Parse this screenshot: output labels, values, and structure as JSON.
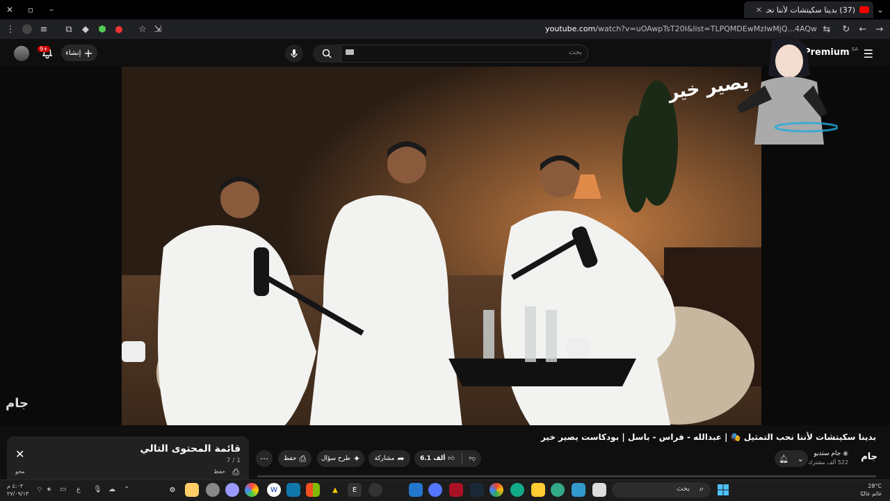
{
  "browser": {
    "tab_title": "(37) بدينا سكيتشات لأننا نحب...",
    "url_domain": "youtube.com",
    "url_path": "/watch?v=uOAwpTsT20I&list=TLPQMDEwMzIwMjQ...4AQw"
  },
  "header": {
    "search_placeholder": "بحث",
    "create_label": "إنشاء",
    "notifications_badge": "9+",
    "logo_text": "Premium",
    "logo_region": "SA"
  },
  "video": {
    "watermark": "يصير خير",
    "side_watermark": "جام"
  },
  "details": {
    "title": "بدينا سكيتشات لأننا نحب التمثيل 🎭 | عبدالله - فراس - باسل | بودكاست يصير خير",
    "channel_name": "جام ستديو",
    "subscribers": "522 ألف مشترك",
    "channel_logo": "جام",
    "likes": "6.1 ألف",
    "share_label": "مشاركة",
    "ask_label": "طرح سؤال",
    "save_label": "حفظ"
  },
  "playlist": {
    "title": "قائمة المحتوى التالي",
    "count": "7 / 1",
    "save_label": "حفظ",
    "left_label": "محو"
  },
  "taskbar": {
    "search_label": "بحث",
    "temperature": "28°C",
    "weather_text": "غائم غالبًا",
    "time": "٤:٠٣ م",
    "date": "٢٧/٠٩/١٣",
    "lang": "ع"
  }
}
